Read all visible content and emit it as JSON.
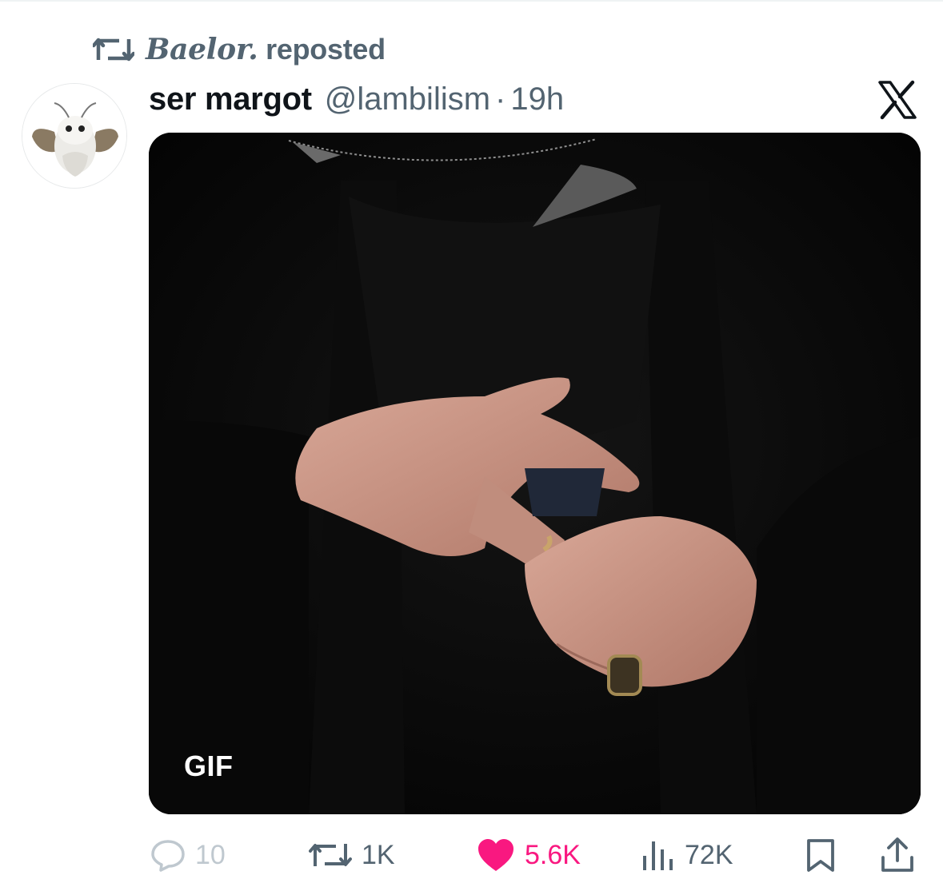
{
  "repost": {
    "icon": "repost-icon",
    "name": "Baelor.",
    "action": "reposted"
  },
  "author": {
    "display_name": "ser margot",
    "handle": "@lambilism",
    "separator": "·",
    "time": "19h",
    "avatar": "avatar-image"
  },
  "brand": {
    "icon": "x-logo-icon"
  },
  "media": {
    "badge": "GIF"
  },
  "actions": {
    "reply": {
      "icon": "reply-icon",
      "count": "10"
    },
    "repost": {
      "icon": "repost-icon",
      "count": "1K"
    },
    "like": {
      "icon": "heart-icon",
      "count": "5.6K",
      "active": true
    },
    "views": {
      "icon": "views-chart-icon",
      "count": "72K"
    },
    "bookmark": {
      "icon": "bookmark-icon"
    },
    "share": {
      "icon": "share-icon"
    }
  },
  "colors": {
    "text_primary": "#0f1419",
    "text_secondary": "#536471",
    "like_active": "#f91880",
    "muted": "#bfc8cf"
  }
}
